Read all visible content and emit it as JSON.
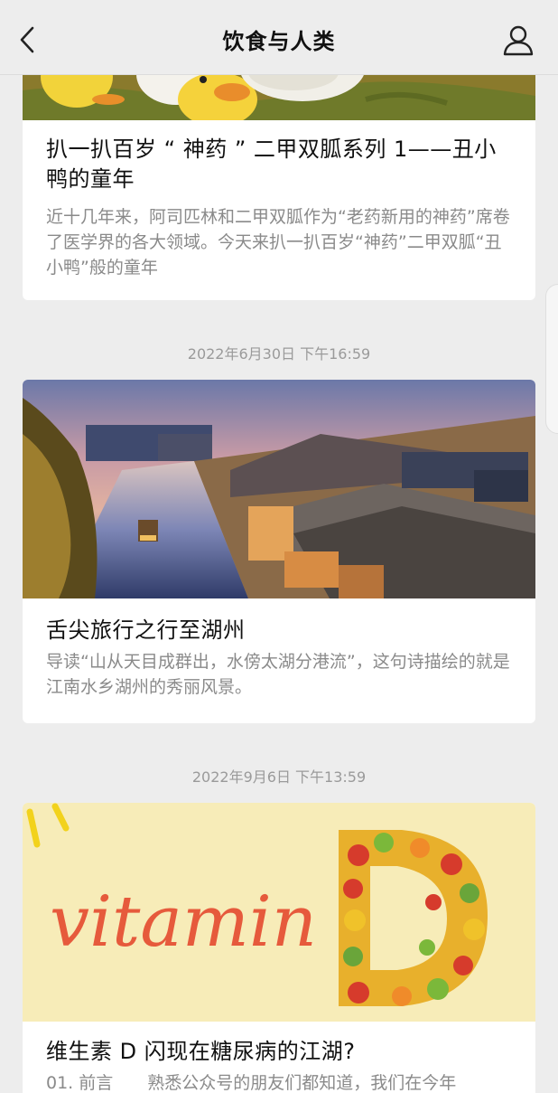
{
  "header": {
    "title": "饮食与人类",
    "back_icon": "chevron-left-icon",
    "user_icon": "user-profile-icon"
  },
  "articles": [
    {
      "title": "扒一扒百岁 “ 神药 ” 二甲双胍系列 1——丑小鸭的童年",
      "summary": "近十几年来，阿司匹林和二甲双胍作为“老药新用的神药”席卷了医学界的各大领域。今天来扒一扒百岁“神药”二甲双胍“丑小鸭”般的童年"
    },
    {
      "timestamp": "2022年6月30日 下午16:59",
      "title": "舌尖旅行之行至湖州",
      "summary": "导读“山从天目成群出，水傍太湖分港流”，这句诗描绘的就是江南水乡湖州的秀丽风景。"
    },
    {
      "timestamp": "2022年9月6日 下午13:59",
      "image_text": "vitamin",
      "title": "维生素 D 闪现在糖尿病的江湖?",
      "summary": "01. 前言　　熟悉公众号的朋友们都知道，我们在今年"
    }
  ],
  "colors": {
    "background": "#ededed",
    "card": "#ffffff",
    "summary_text": "#8a8a8a",
    "timestamp_text": "#9a9a9a"
  }
}
